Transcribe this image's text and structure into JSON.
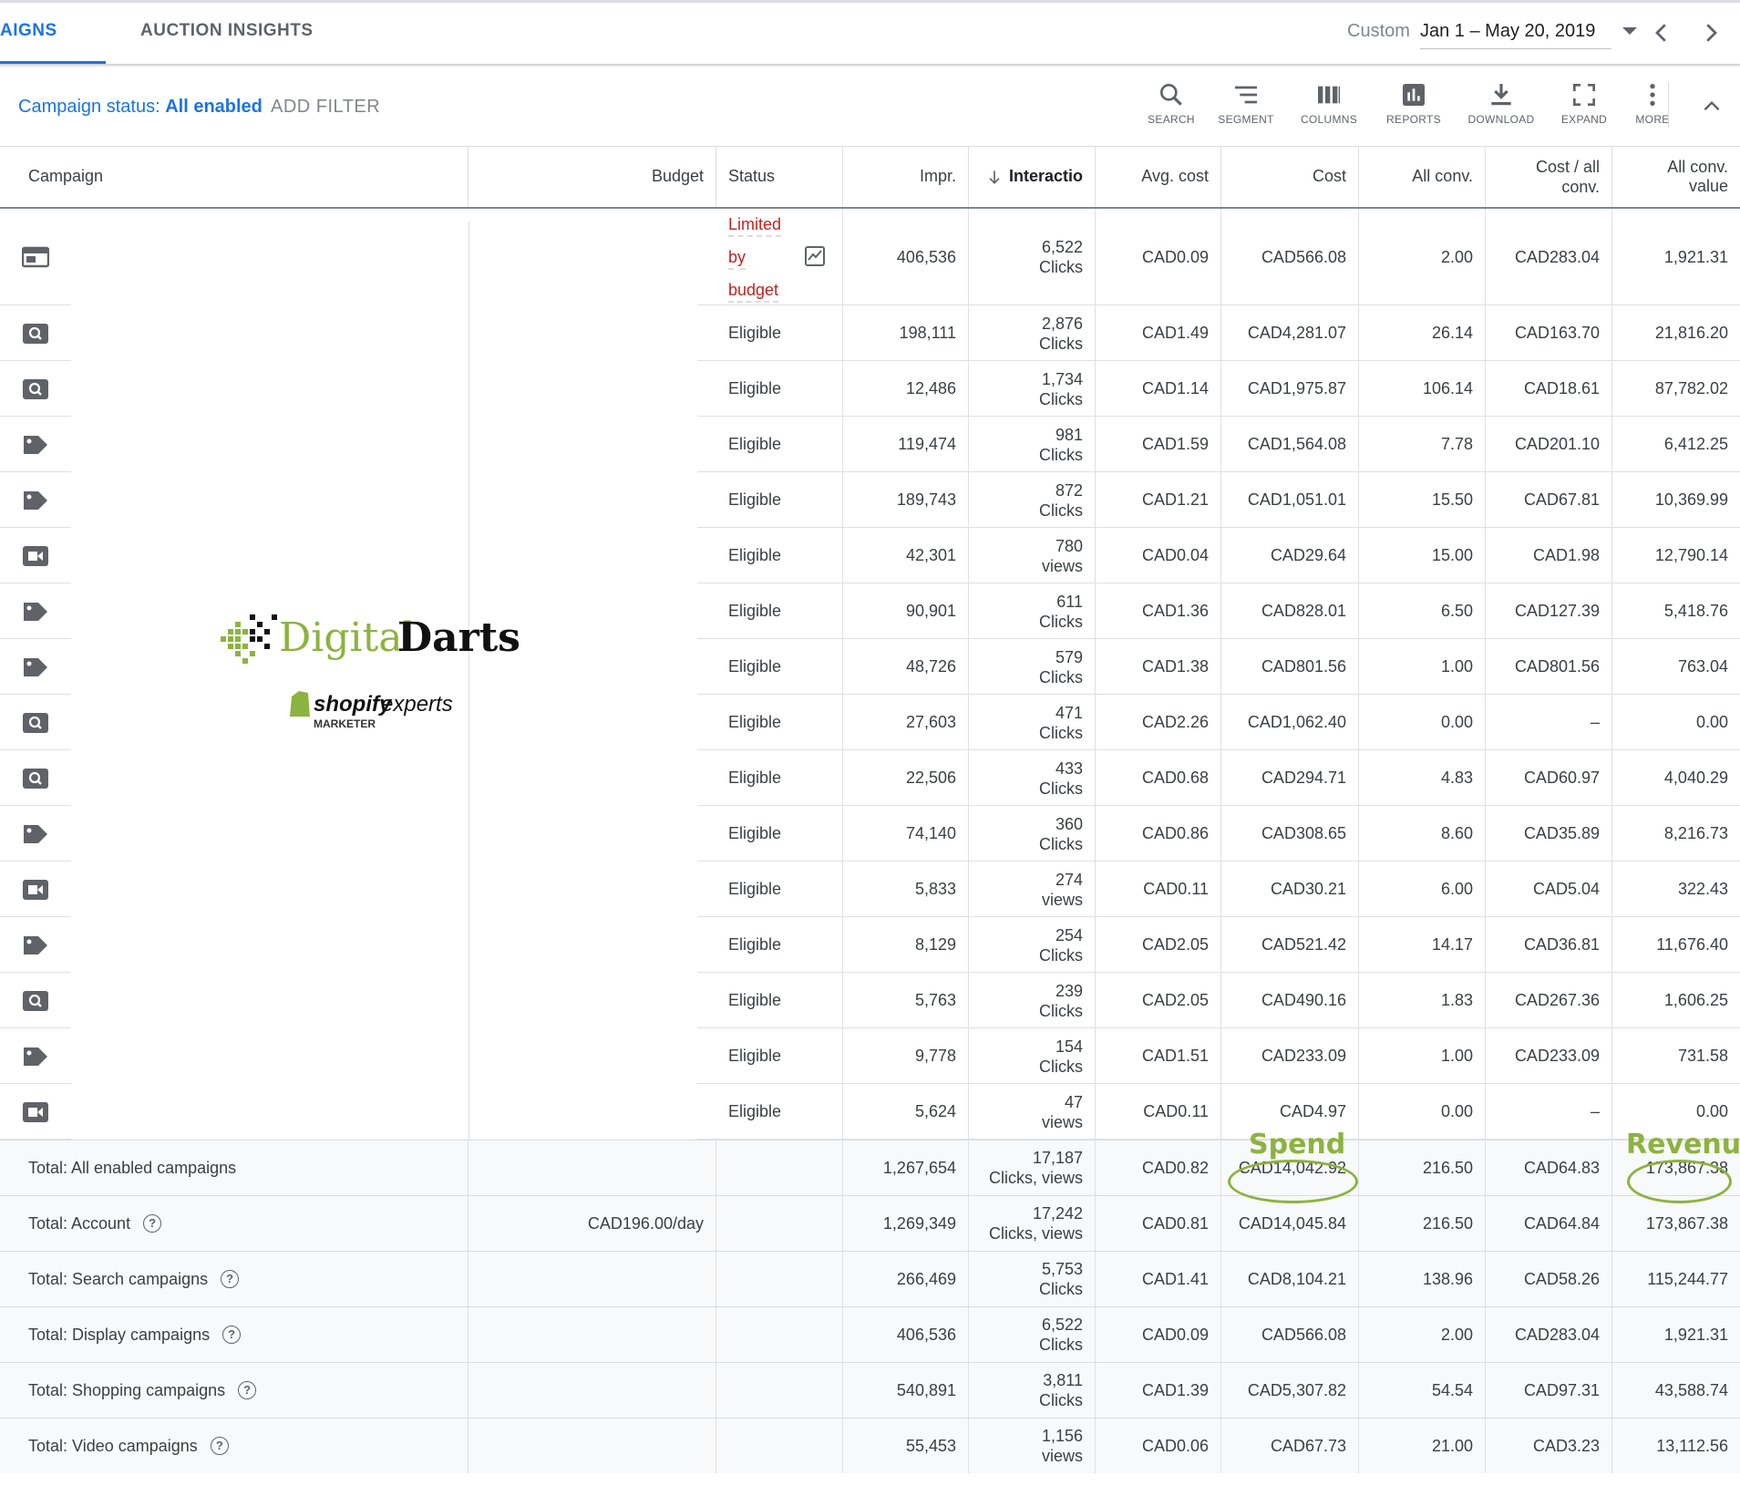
{
  "tabs": {
    "campaigns": "AIGNS",
    "auction_insights": "AUCTION INSIGHTS"
  },
  "date_range": {
    "preset": "Custom",
    "dates": "Jan 1 – May 20, 2019"
  },
  "filter": {
    "label_prefix": "Campaign status: ",
    "label_value": "All enabled",
    "add_filter": "ADD FILTER"
  },
  "toolbar": {
    "search": "SEARCH",
    "segment": "SEGMENT",
    "columns": "COLUMNS",
    "reports": "REPORTS",
    "download": "DOWNLOAD",
    "expand": "EXPAND",
    "more": "MORE"
  },
  "columns": {
    "campaign": "Campaign",
    "budget": "Budget",
    "status": "Status",
    "impr": "Impr.",
    "interactions": "Interactio",
    "avg_cost": "Avg. cost",
    "cost": "Cost",
    "all_conv": "All conv.",
    "cost_all_conv_1": "Cost / all",
    "cost_all_conv_2": "conv.",
    "all_conv_value": "All conv. value"
  },
  "rows": [
    {
      "type": "display",
      "status": "Limited by budget",
      "impr": "406,536",
      "inter": "6,522",
      "unit": "Clicks",
      "avg": "CAD0.09",
      "cost": "CAD566.08",
      "conv": "2.00",
      "cpc": "CAD283.04",
      "val": "1,921.31"
    },
    {
      "type": "search",
      "status": "Eligible",
      "impr": "198,111",
      "inter": "2,876",
      "unit": "Clicks",
      "avg": "CAD1.49",
      "cost": "CAD4,281.07",
      "conv": "26.14",
      "cpc": "CAD163.70",
      "val": "21,816.20"
    },
    {
      "type": "search",
      "status": "Eligible",
      "impr": "12,486",
      "inter": "1,734",
      "unit": "Clicks",
      "avg": "CAD1.14",
      "cost": "CAD1,975.87",
      "conv": "106.14",
      "cpc": "CAD18.61",
      "val": "87,782.02"
    },
    {
      "type": "shopping",
      "status": "Eligible",
      "impr": "119,474",
      "inter": "981",
      "unit": "Clicks",
      "avg": "CAD1.59",
      "cost": "CAD1,564.08",
      "conv": "7.78",
      "cpc": "CAD201.10",
      "val": "6,412.25"
    },
    {
      "type": "shopping",
      "status": "Eligible",
      "impr": "189,743",
      "inter": "872",
      "unit": "Clicks",
      "avg": "CAD1.21",
      "cost": "CAD1,051.01",
      "conv": "15.50",
      "cpc": "CAD67.81",
      "val": "10,369.99"
    },
    {
      "type": "video",
      "status": "Eligible",
      "impr": "42,301",
      "inter": "780",
      "unit": "views",
      "avg": "CAD0.04",
      "cost": "CAD29.64",
      "conv": "15.00",
      "cpc": "CAD1.98",
      "val": "12,790.14"
    },
    {
      "type": "shopping",
      "status": "Eligible",
      "impr": "90,901",
      "inter": "611",
      "unit": "Clicks",
      "avg": "CAD1.36",
      "cost": "CAD828.01",
      "conv": "6.50",
      "cpc": "CAD127.39",
      "val": "5,418.76"
    },
    {
      "type": "shopping",
      "status": "Eligible",
      "impr": "48,726",
      "inter": "579",
      "unit": "Clicks",
      "avg": "CAD1.38",
      "cost": "CAD801.56",
      "conv": "1.00",
      "cpc": "CAD801.56",
      "val": "763.04"
    },
    {
      "type": "search",
      "status": "Eligible",
      "impr": "27,603",
      "inter": "471",
      "unit": "Clicks",
      "avg": "CAD2.26",
      "cost": "CAD1,062.40",
      "conv": "0.00",
      "cpc": "–",
      "val": "0.00"
    },
    {
      "type": "search",
      "status": "Eligible",
      "impr": "22,506",
      "inter": "433",
      "unit": "Clicks",
      "avg": "CAD0.68",
      "cost": "CAD294.71",
      "conv": "4.83",
      "cpc": "CAD60.97",
      "val": "4,040.29"
    },
    {
      "type": "shopping",
      "status": "Eligible",
      "impr": "74,140",
      "inter": "360",
      "unit": "Clicks",
      "avg": "CAD0.86",
      "cost": "CAD308.65",
      "conv": "8.60",
      "cpc": "CAD35.89",
      "val": "8,216.73"
    },
    {
      "type": "video",
      "status": "Eligible",
      "impr": "5,833",
      "inter": "274",
      "unit": "views",
      "avg": "CAD0.11",
      "cost": "CAD30.21",
      "conv": "6.00",
      "cpc": "CAD5.04",
      "val": "322.43"
    },
    {
      "type": "shopping",
      "status": "Eligible",
      "impr": "8,129",
      "inter": "254",
      "unit": "Clicks",
      "avg": "CAD2.05",
      "cost": "CAD521.42",
      "conv": "14.17",
      "cpc": "CAD36.81",
      "val": "11,676.40"
    },
    {
      "type": "search",
      "status": "Eligible",
      "impr": "5,763",
      "inter": "239",
      "unit": "Clicks",
      "avg": "CAD2.05",
      "cost": "CAD490.16",
      "conv": "1.83",
      "cpc": "CAD267.36",
      "val": "1,606.25"
    },
    {
      "type": "shopping",
      "status": "Eligible",
      "impr": "9,778",
      "inter": "154",
      "unit": "Clicks",
      "avg": "CAD1.51",
      "cost": "CAD233.09",
      "conv": "1.00",
      "cpc": "CAD233.09",
      "val": "731.58"
    },
    {
      "type": "video",
      "status": "Eligible",
      "impr": "5,624",
      "inter": "47",
      "unit": "views",
      "avg": "CAD0.11",
      "cost": "CAD4.97",
      "conv": "0.00",
      "cpc": "–",
      "val": "0.00"
    }
  ],
  "totals": [
    {
      "label": "Total: All enabled campaigns",
      "help": false,
      "budget": "",
      "impr": "1,267,654",
      "inter": "17,187",
      "unit": "Clicks, views",
      "avg": "CAD0.82",
      "cost": "CAD14,042.92",
      "conv": "216.50",
      "cpc": "CAD64.83",
      "val": "173,867.38"
    },
    {
      "label": "Total: Account",
      "help": true,
      "budget": "CAD196.00/day",
      "impr": "1,269,349",
      "inter": "17,242",
      "unit": "Clicks, views",
      "avg": "CAD0.81",
      "cost": "CAD14,045.84",
      "conv": "216.50",
      "cpc": "CAD64.84",
      "val": "173,867.38"
    },
    {
      "label": "Total: Search campaigns",
      "help": true,
      "budget": "",
      "impr": "266,469",
      "inter": "5,753",
      "unit": "Clicks",
      "avg": "CAD1.41",
      "cost": "CAD8,104.21",
      "conv": "138.96",
      "cpc": "CAD58.26",
      "val": "115,244.77"
    },
    {
      "label": "Total: Display campaigns",
      "help": true,
      "budget": "",
      "impr": "406,536",
      "inter": "6,522",
      "unit": "Clicks",
      "avg": "CAD0.09",
      "cost": "CAD566.08",
      "conv": "2.00",
      "cpc": "CAD283.04",
      "val": "1,921.31"
    },
    {
      "label": "Total: Shopping campaigns",
      "help": true,
      "budget": "",
      "impr": "540,891",
      "inter": "3,811",
      "unit": "Clicks",
      "avg": "CAD1.39",
      "cost": "CAD5,307.82",
      "conv": "54.54",
      "cpc": "CAD97.31",
      "val": "43,588.74"
    },
    {
      "label": "Total: Video campaigns",
      "help": true,
      "budget": "",
      "impr": "55,453",
      "inter": "1,156",
      "unit": "views",
      "avg": "CAD0.06",
      "cost": "CAD67.73",
      "conv": "21.00",
      "cpc": "CAD3.23",
      "val": "13,112.56"
    }
  ],
  "annotations": {
    "spend": "Spend",
    "revenue": "Revenue"
  },
  "logo": {
    "digital": "Digital",
    "darts": "Darts",
    "shopify": "shopify",
    "experts": "experts",
    "marketer": "MARKETER"
  },
  "colors": {
    "accent": "#1a73e8",
    "limited": "#c5221f",
    "annotation": "#8cb33f"
  }
}
